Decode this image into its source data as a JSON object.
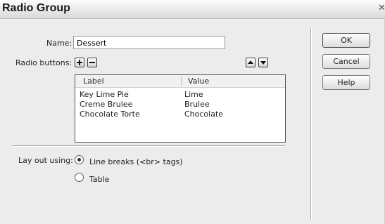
{
  "window": {
    "title": "Radio Group",
    "close_glyph": "✕"
  },
  "form": {
    "name_label": "Name:",
    "name_value": "Dessert",
    "radio_buttons_label": "Radio buttons:"
  },
  "toolbar_icons": [
    "plus-icon",
    "minus-icon",
    "arrow-up-icon",
    "arrow-down-icon"
  ],
  "table": {
    "columns": [
      "Label",
      "Value"
    ],
    "rows": [
      {
        "label": "Key Lime Pie",
        "value": "Lime"
      },
      {
        "label": "Creme Brulee",
        "value": "Brulee"
      },
      {
        "label": "Chocolate Torte",
        "value": "Chocolate"
      }
    ]
  },
  "layout_options": {
    "label": "Lay out using:",
    "options": [
      {
        "label": "Line breaks (<br> tags)",
        "selected": true
      },
      {
        "label": "Table",
        "selected": false
      }
    ]
  },
  "buttons": {
    "ok": "OK",
    "cancel": "Cancel",
    "help": "Help"
  }
}
